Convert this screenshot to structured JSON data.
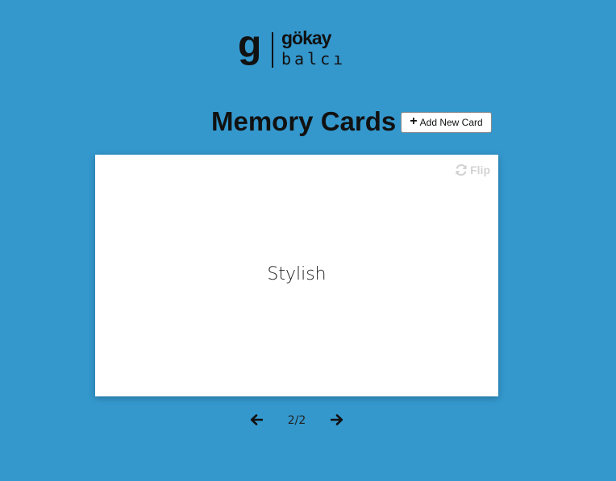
{
  "logo": {
    "mark": "g",
    "top_text": "gökay",
    "bottom_text": "balcı"
  },
  "header": {
    "title": "Memory Cards",
    "add_button_icon": "plus-icon",
    "add_button_label": "Add New Card"
  },
  "card": {
    "text": "Stylish",
    "flip_icon": "refresh-icon",
    "flip_label": "Flip"
  },
  "navigation": {
    "prev_icon": "arrow-left-icon",
    "next_icon": "arrow-right-icon",
    "counter": "2/2"
  },
  "colors": {
    "background": "#3498cd",
    "card": "#ffffff",
    "flip_text": "#d3d3d3"
  }
}
